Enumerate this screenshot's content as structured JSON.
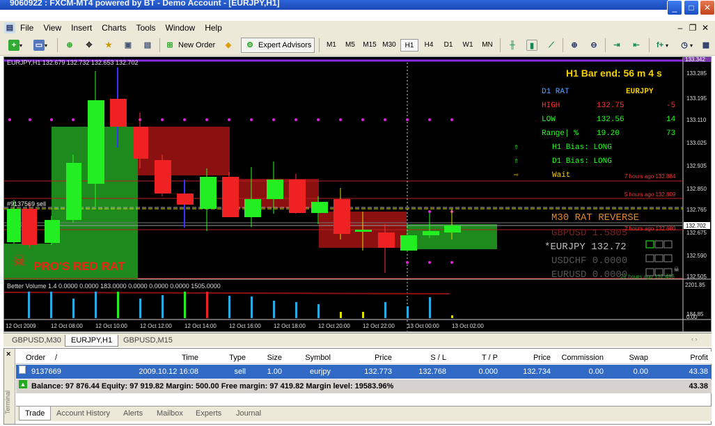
{
  "window": {
    "title": "9060922 : FXCM-MT4 powered by BT - Demo Account - [EURJPY,H1]"
  },
  "menu": [
    "File",
    "View",
    "Insert",
    "Charts",
    "Tools",
    "Window",
    "Help"
  ],
  "toolbar": {
    "new_order": "New Order",
    "expert_advisors": "Expert Advisors",
    "timeframes": [
      "M1",
      "M5",
      "M15",
      "M30",
      "H1",
      "H4",
      "D1",
      "W1",
      "MN"
    ],
    "active_timeframe": "H1"
  },
  "chart": {
    "header": "EURJPY,H1  132.679 132.732 132.653 132.702",
    "bar_end": "H1 Bar end: 56 m 4 s",
    "d1_rat": "D1 RAT",
    "symbol": "EURJPY",
    "high_label": "HIGH",
    "high_val": "132.75",
    "high_diff": "-5",
    "low_label": "LOW",
    "low_val": "132.56",
    "low_diff": "14",
    "range_label": "Range| %",
    "range_val": "19.20",
    "range_pct": "73",
    "h1_bias": "H1 Bias: LONG",
    "d1_bias": "D1 Bias: LONG",
    "wait": "Wait",
    "ago1": "7 hours ago 132.884",
    "ago2": "5 hours ago 132.809",
    "ago3": "2 hours ago 132.680",
    "ago4": "21 hours ago 132.486",
    "m30_title": "M30 RAT REVERSE",
    "w1": "GBPUSD 1.5805",
    "w2": "*EURJPY 132.72",
    "w3": "USDCHF 0.0000",
    "w4": "EURUSD 0.0000",
    "order_label": "#9137569 sell",
    "brand": "PRO'S RED RAT",
    "ind_header": "Better Volume 1.4 0.0000 0.0000 183.0000 0.0000 0.0000 0.0000 1505.0000",
    "current_price": "132.702",
    "top_price": "133.342",
    "price_ticks": [
      "133.285",
      "133.195",
      "133.110",
      "133.025",
      "132.935",
      "132.850",
      "132.765",
      "132.675",
      "132.590",
      "132.505"
    ],
    "ind_ticks": [
      "2201.85",
      "184.85",
      "0.00"
    ],
    "time_ticks": [
      "12 Oct 2009",
      "12 Oct 08:00",
      "12 Oct 10:00",
      "12 Oct 12:00",
      "12 Oct 14:00",
      "12 Oct 16:00",
      "12 Oct 18:00",
      "12 Oct 20:00",
      "12 Oct 22:00",
      "13 Oct 00:00",
      "13 Oct 02:00"
    ]
  },
  "chart_tabs": [
    "GBPUSD,M30",
    "EURJPY,H1",
    "GBPUSD,M15"
  ],
  "active_chart_tab": "EURJPY,H1",
  "terminal": {
    "side_label": "Terminal",
    "columns": [
      "Order",
      "/",
      "Time",
      "Type",
      "Size",
      "Symbol",
      "Price",
      "S / L",
      "T / P",
      "Price",
      "Commission",
      "Swap",
      "Profit"
    ],
    "row": {
      "order": "9137669",
      "time": "2009.10.12 16:08",
      "type": "sell",
      "size": "1.00",
      "symbol": "eurjpy",
      "price": "132.773",
      "sl": "132.768",
      "tp": "0.000",
      "cur_price": "132.734",
      "commission": "0.00",
      "swap": "0.00",
      "profit": "43.38"
    },
    "balance": "Balance: 97 876.44  Equity: 97 919.82  Margin: 500.00  Free margin: 97 419.82  Margin level: 19583.96%",
    "balance_profit": "43.38",
    "tabs": [
      "Trade",
      "Account History",
      "Alerts",
      "Mailbox",
      "Experts",
      "Journal"
    ]
  }
}
